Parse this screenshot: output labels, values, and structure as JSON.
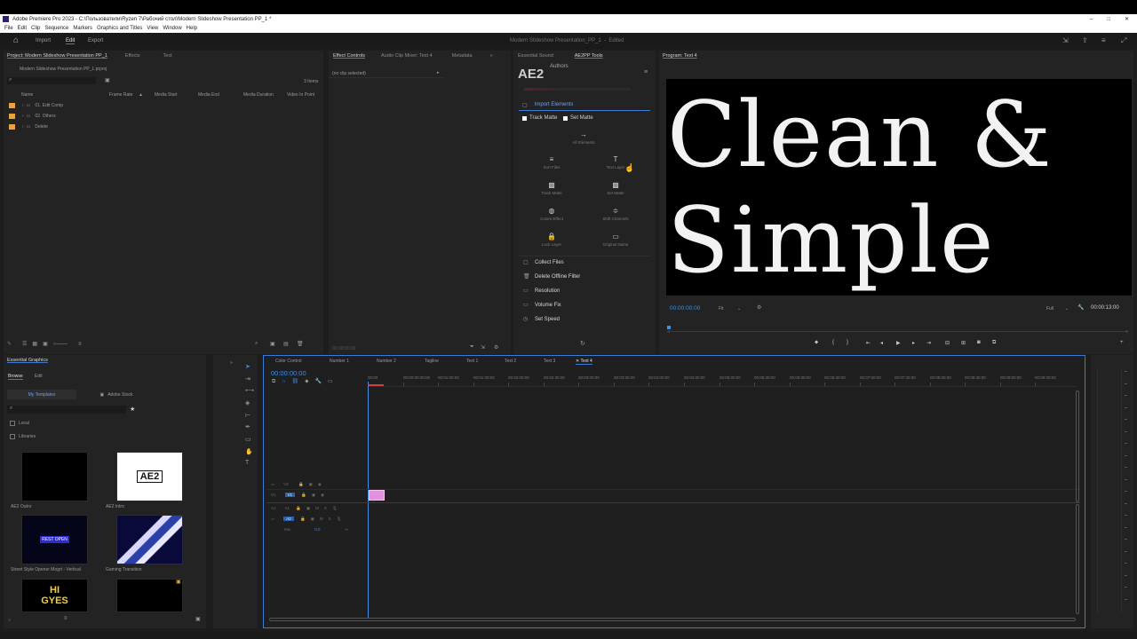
{
  "window": {
    "title": "Adobe Premiere Pro 2023 - C:\\Пользователи\\Ryzen 7\\Рабочий стол\\Modern Slideshow Presentation PP_1 *",
    "controls": [
      "–",
      "□",
      "✕"
    ]
  },
  "menu": [
    "File",
    "Edit",
    "Clip",
    "Sequence",
    "Markers",
    "Graphics and Titles",
    "View",
    "Window",
    "Help"
  ],
  "header": {
    "home_icon": "home-icon",
    "workspaces": [
      "Import",
      "Edit",
      "Export"
    ],
    "active_workspace": "Edit",
    "project_title": "Modern Slideshow Presentation_PP_1",
    "edited": "Edited"
  },
  "project_panel": {
    "tabs": [
      "Project: Modern Slideshow Presentation PP_1",
      "Effects",
      "Text"
    ],
    "file": "Modern Slideshow Presentation PP_1.prproj",
    "item_count": "3 Items",
    "columns": [
      "Name",
      "Frame Rate",
      "Media Start",
      "Media End",
      "Media Duration",
      "Video In Point"
    ],
    "rows": [
      "01. Edit Comp",
      "02. Others",
      "Delete"
    ],
    "accent": "#e8a43a"
  },
  "effect_controls": {
    "tabs": [
      "Effect Controls",
      "Audio Clip Mixer: Text 4",
      "Metadata"
    ],
    "no_clip": "(no clip selected)",
    "timecode": "00:00:00:00"
  },
  "ae2_panel": {
    "tabs": [
      "Essential Sound",
      "AE2PP Tools"
    ],
    "logo": "AE2",
    "authors": "Authors",
    "import_elements": "Import Elements",
    "track_matte": "Track Matte",
    "set_matte": "Set Matte",
    "buttons": [
      {
        "label": "All Elements",
        "icon": "→"
      },
      {
        "label": "Sort Files",
        "icon": "≡"
      },
      {
        "label": "Text Layer",
        "icon": "T"
      },
      {
        "label": "Track Matte",
        "icon": "▩"
      },
      {
        "label": "Set Matte",
        "icon": "▩"
      },
      {
        "label": "Colors Effect",
        "icon": "◍"
      },
      {
        "label": "Shift Channels",
        "icon": "≑"
      },
      {
        "label": "Lock Layer",
        "icon": "🔒"
      },
      {
        "label": "Original Name",
        "icon": "▭"
      }
    ],
    "list": [
      {
        "label": "Collect Files",
        "icon": "▢"
      },
      {
        "label": "Delete Offline Filter",
        "icon": "🗑"
      },
      {
        "label": "Resolution",
        "icon": "▭"
      },
      {
        "label": "Volume Fix",
        "icon": "▭"
      },
      {
        "label": "Set Speed",
        "icon": "◷"
      }
    ],
    "refresh_icon": "↻"
  },
  "program_monitor": {
    "tab": "Program: Text 4",
    "text_line1": "Clean &",
    "text_line2": "Simple",
    "timecode": "00:00:00:00",
    "fit": "Fit",
    "quality": "Full",
    "duration": "00:00:13:00"
  },
  "essential_graphics": {
    "tab": "Essential Graphics",
    "subtabs": [
      "Browse",
      "Edit"
    ],
    "sources": [
      "My Templates",
      "Adobe Stock"
    ],
    "checkboxes": [
      "Local",
      "Libraries"
    ],
    "thumbs": [
      {
        "caption": "AE2 Outro",
        "text": ""
      },
      {
        "caption": "AE2 Intro",
        "text": "AE2"
      },
      {
        "caption": "Street Style Opener Mogrt - Vertical",
        "text": "REST OPEN"
      },
      {
        "caption": "Gaming Transition",
        "text": ""
      },
      {
        "caption": "",
        "text": "HI GYES"
      },
      {
        "caption": "",
        "text": ""
      }
    ]
  },
  "timeline": {
    "tabs": [
      "Color Control",
      "Number 1",
      "Number 2",
      "Tagline",
      "Text 1",
      "Text 2",
      "Text 3",
      "Text 4"
    ],
    "active_tab": "Text 4",
    "timecode": "00:00:00:00",
    "ruler": [
      "00:00",
      "00:00:00:30:00",
      "00:01:00:00",
      "00:01:30:00",
      "00:02:00:00",
      "00:02:30:00",
      "00:03:00:00",
      "00:03:30:00",
      "00:04:00:00",
      "00:04:30:00",
      "00:05:00:00",
      "00:05:30:00",
      "00:06:00:00",
      "00:06:30:00",
      "00:07:00:00",
      "00:07:30:00",
      "00:08:00:00",
      "00:08:30:00",
      "00:09:00:00",
      "00:09:30:00"
    ],
    "tracks": [
      "V2",
      "V1",
      "A1",
      "A2",
      "Mix"
    ],
    "mix_value": "0.0",
    "clip_color": "#e58fe0",
    "playhead_color": "#3a7bd5"
  }
}
